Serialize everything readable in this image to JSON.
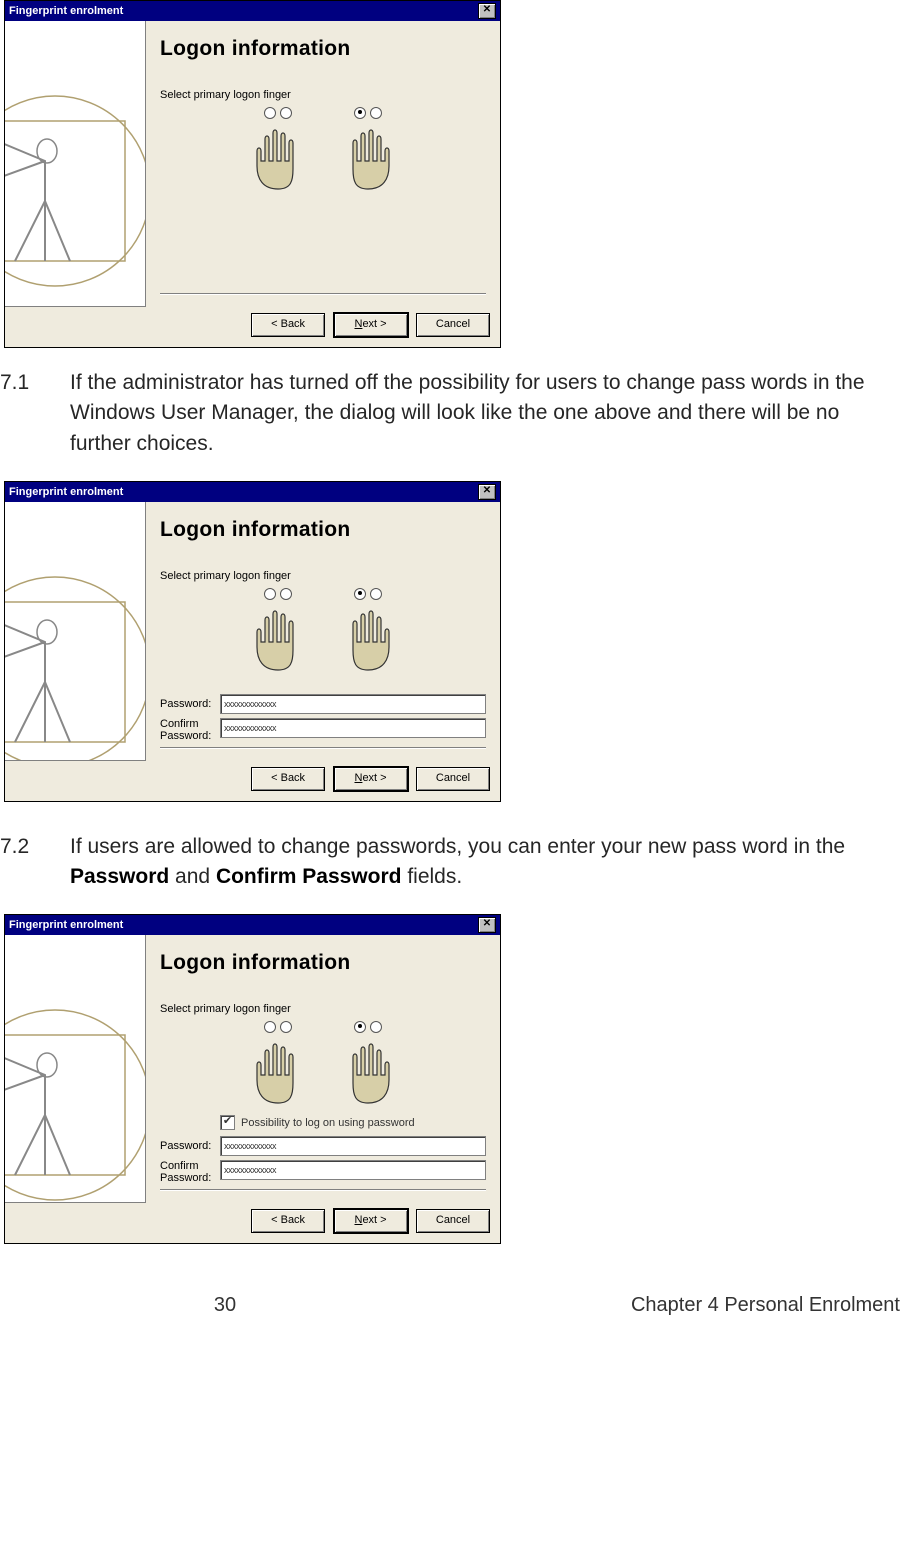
{
  "dialogs": {
    "title": "Fingerprint enrolment",
    "close_glyph": "✕",
    "heading": "Logon information",
    "instruction": "Select primary logon finger",
    "password_label": "Password:",
    "confirm_label": "Confirm Password:",
    "password_value": "xxxxxxxxxxxxx",
    "confirm_value": "xxxxxxxxxxxxx",
    "checkbox_label": "Possibility to log on using password",
    "checkbox_checked": "✔",
    "back_btn": "< Back",
    "next_btn": "Next >",
    "cancel_btn": "Cancel"
  },
  "paragraphs": {
    "p71_num": "7.1",
    "p71_text": "If the administrator has turned off the possibility for users to change pass words in the Windows User Manager, the dialog will look like the one above and there will be no further choices.",
    "p72_num": "7.2",
    "p72_a": "If users are allowed to change passwords, you can enter your new pass word in the ",
    "p72_b1": "Password",
    "p72_mid": " and ",
    "p72_b2": "Confirm Password",
    "p72_end": " fields."
  },
  "footer": {
    "page_number": "30",
    "chapter": "Chapter 4 Personal Enrolment"
  }
}
